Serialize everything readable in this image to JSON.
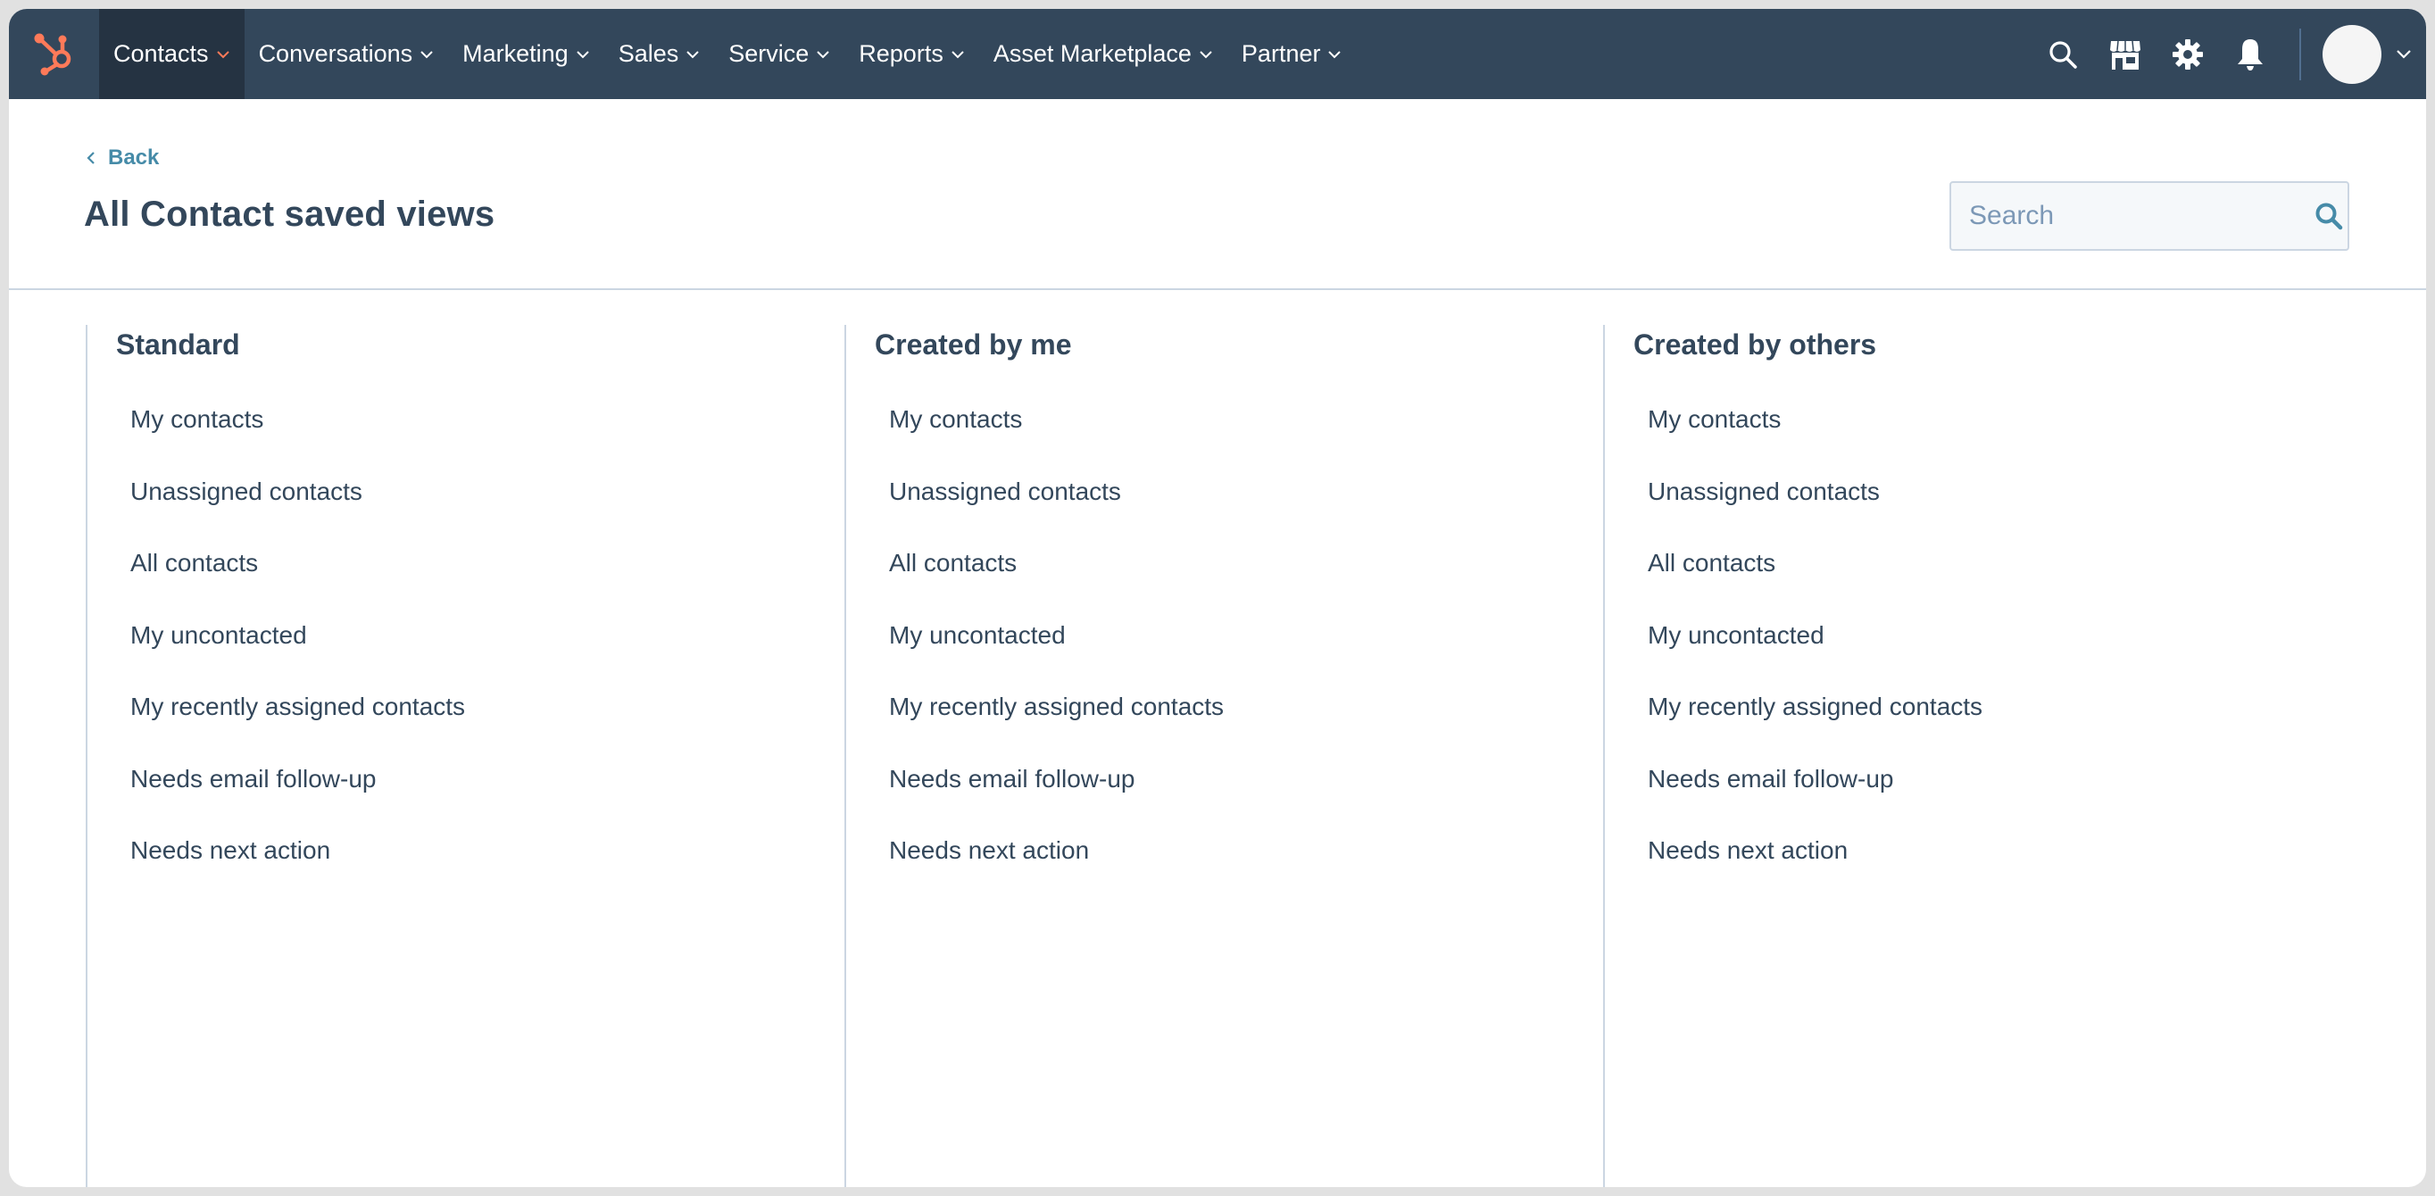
{
  "nav": {
    "logo": "hubspot-sprocket-logo",
    "brand_color": "#ff7a59",
    "menu": [
      {
        "label": "Contacts",
        "active": true
      },
      {
        "label": "Conversations",
        "active": false
      },
      {
        "label": "Marketing",
        "active": false
      },
      {
        "label": "Sales",
        "active": false
      },
      {
        "label": "Service",
        "active": false
      },
      {
        "label": "Reports",
        "active": false
      },
      {
        "label": "Asset Marketplace",
        "active": false
      },
      {
        "label": "Partner",
        "active": false
      }
    ],
    "icons": [
      "search-icon",
      "marketplace-icon",
      "gear-icon",
      "bell-icon"
    ]
  },
  "header": {
    "back_label": "Back",
    "title": "All Contact saved views",
    "search_placeholder": "Search"
  },
  "columns": [
    {
      "heading": "Standard",
      "items": [
        "My contacts",
        "Unassigned contacts",
        "All contacts",
        "My uncontacted",
        "My recently assigned contacts",
        "Needs email follow-up",
        "Needs next action"
      ]
    },
    {
      "heading": "Created by me",
      "items": [
        "My contacts",
        "Unassigned contacts",
        "All contacts",
        "My uncontacted",
        "My recently assigned contacts",
        "Needs email follow-up",
        "Needs next action"
      ]
    },
    {
      "heading": "Created by others",
      "items": [
        "My contacts",
        "Unassigned contacts",
        "All contacts",
        "My uncontacted",
        "My recently assigned contacts",
        "Needs email follow-up",
        "Needs next action"
      ]
    }
  ],
  "colors": {
    "nav_bg": "#33475b",
    "nav_active_bg": "#253342",
    "link": "#468ba8",
    "text": "#33475b",
    "accent": "#ff7a59"
  }
}
